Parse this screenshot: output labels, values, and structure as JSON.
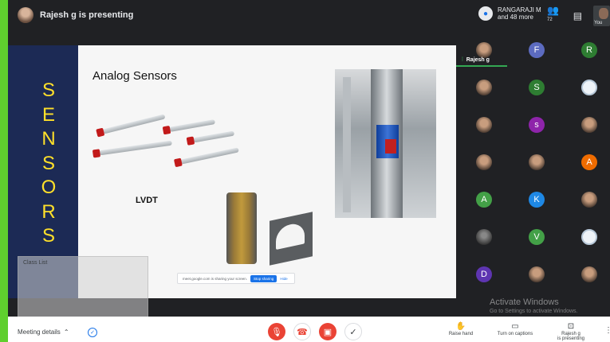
{
  "topbar": {
    "presenter_text": "Rajesh g is presenting",
    "others_name": "RANGARAJI M",
    "others_more": "and 48 more",
    "people_count": "72",
    "you_label": "You"
  },
  "slide": {
    "vertical_word": [
      "S",
      "E",
      "N",
      "S",
      "O",
      "R",
      "S"
    ],
    "title": "Analog Sensors",
    "lvdt_label": "LVDT",
    "share_text": "meet.google.com is sharing your screen.",
    "stop_sharing": "Stop sharing",
    "hide": "Hide"
  },
  "overlay": {
    "title": "Class List"
  },
  "participants": {
    "speaker_name": "Rajesh g",
    "tiles": [
      {
        "type": "photo"
      },
      {
        "type": "letter",
        "letter": "F",
        "color": "#5c6bc0"
      },
      {
        "type": "letter",
        "letter": "R",
        "color": "#2e7d32"
      },
      {
        "type": "photo"
      },
      {
        "type": "letter",
        "letter": "S",
        "color": "#2e7d32"
      },
      {
        "type": "logo"
      },
      {
        "type": "photo"
      },
      {
        "type": "letter",
        "letter": "s",
        "color": "#8e24aa"
      },
      {
        "type": "photo"
      },
      {
        "type": "photo"
      },
      {
        "type": "photo"
      },
      {
        "type": "letter",
        "letter": "A",
        "color": "#ef6c00"
      },
      {
        "type": "letter",
        "letter": "A",
        "color": "#43a047"
      },
      {
        "type": "letter",
        "letter": "K",
        "color": "#1e88e5"
      },
      {
        "type": "photo"
      },
      {
        "type": "dark"
      },
      {
        "type": "letter",
        "letter": "V",
        "color": "#43a047"
      },
      {
        "type": "logo"
      },
      {
        "type": "letter",
        "letter": "D",
        "color": "#5e35b1"
      },
      {
        "type": "photo"
      },
      {
        "type": "photo"
      }
    ]
  },
  "watermark": {
    "line1": "Activate Windows",
    "line2": "Go to Settings to activate Windows."
  },
  "bottombar": {
    "meeting_details": "Meeting details",
    "raise_hand": "Raise hand",
    "captions": "Turn on captions",
    "presenting_line1": "Rajesh g",
    "presenting_line2": "is presenting"
  },
  "colors": {
    "accent_green": "#34a853",
    "slide_band": "#1c2a55",
    "slide_letters": "#ffe02a",
    "danger": "#ea4335"
  }
}
